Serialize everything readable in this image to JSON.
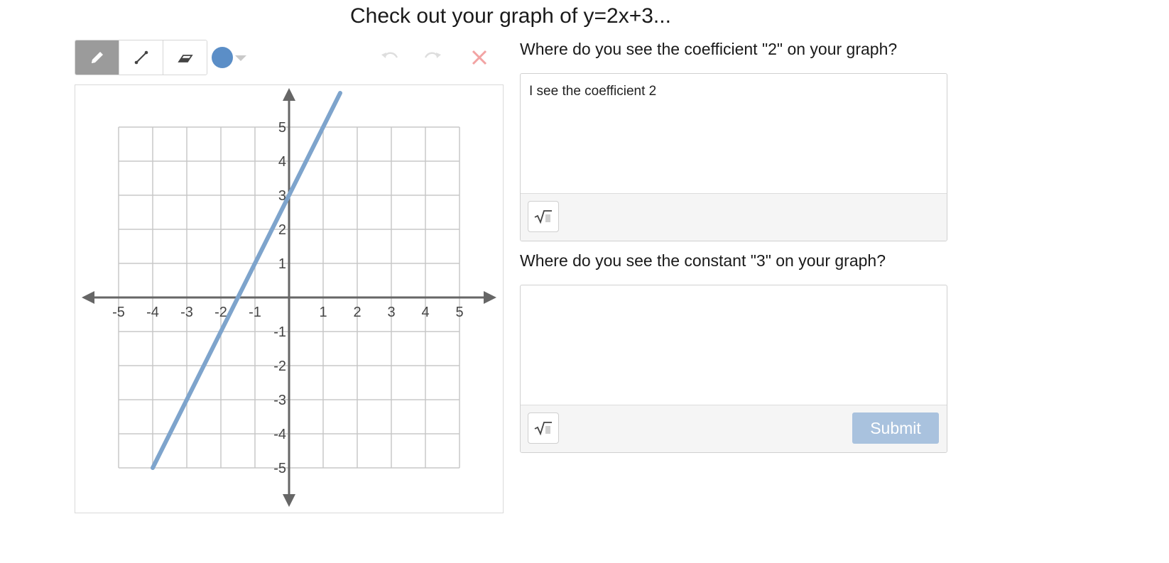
{
  "page_title": "Check out your graph of y=2x+3...",
  "toolbar": {
    "tools": [
      {
        "name": "pencil-icon",
        "active": true
      },
      {
        "name": "line-segment-icon",
        "active": false
      },
      {
        "name": "eraser-icon",
        "active": false
      }
    ],
    "color": "#5b8ec7",
    "undo_icon": "undo-icon",
    "redo_icon": "redo-icon",
    "clear_icon": "clear-icon"
  },
  "graph": {
    "x_range": [
      -5,
      5
    ],
    "y_range": [
      -5,
      5
    ],
    "x_ticks": [
      "-5",
      "-4",
      "-3",
      "-2",
      "-1",
      "1",
      "2",
      "3",
      "4",
      "5"
    ],
    "y_ticks": [
      "5",
      "4",
      "3",
      "2",
      "1",
      "-1",
      "-2",
      "-3",
      "-4",
      "-5"
    ],
    "line": {
      "equation": "y=2x+3",
      "from": [
        -4,
        -5
      ],
      "to": [
        1.5,
        6
      ],
      "color": "#7ea4cc"
    }
  },
  "questions": [
    {
      "prompt": "Where do you see the coefficient \"2\" on your graph?",
      "answer": "I see the coefficient 2"
    },
    {
      "prompt": "Where do you see the constant \"3\" on your graph?",
      "answer": ""
    }
  ],
  "submit_label": "Submit",
  "colors": {
    "submit_bg": "#a9c2de",
    "active_tool": "#9b9b9b",
    "clear": "#f2a3a3"
  }
}
